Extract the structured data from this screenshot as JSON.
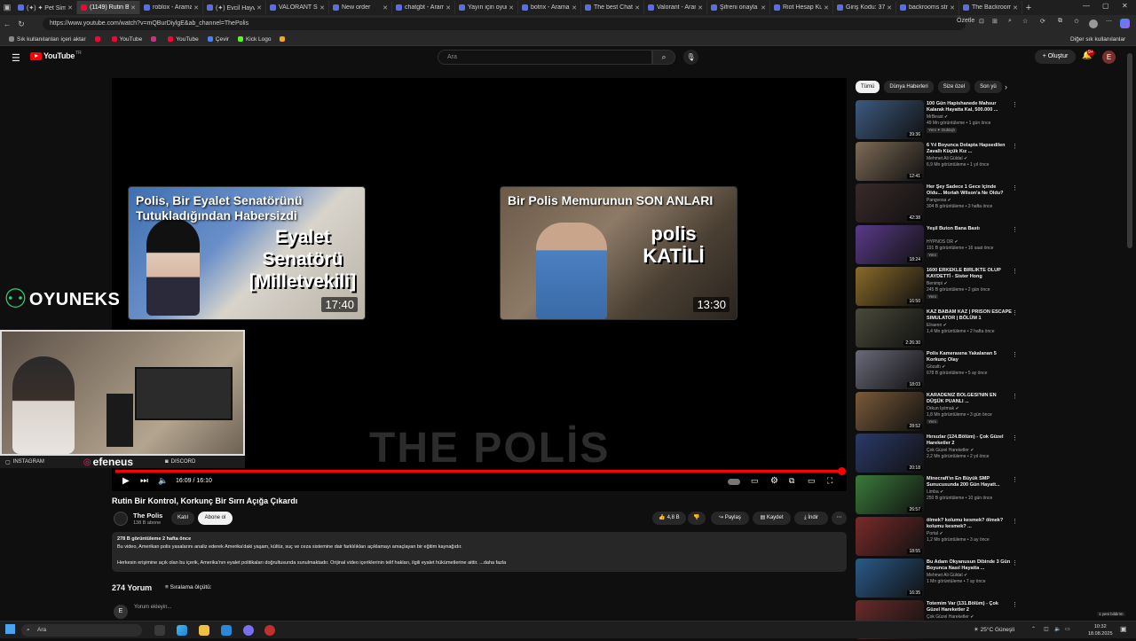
{
  "browser": {
    "tabs": [
      {
        "label": "(✦) ✦ Pet Sim"
      },
      {
        "label": "(1149) Rutin Bi",
        "active": true
      },
      {
        "label": "roblox - Arama"
      },
      {
        "label": "(✦) Evcil Hayv"
      },
      {
        "label": "VALORANT Str"
      },
      {
        "label": "New order"
      },
      {
        "label": "chatgbt - Aram"
      },
      {
        "label": "Yayın için oyun"
      },
      {
        "label": "botrix - Arama"
      },
      {
        "label": "The best Chatb"
      },
      {
        "label": "Valorant - Aram"
      },
      {
        "label": "Şifreni onayla"
      },
      {
        "label": "Riot Hesap Kur"
      },
      {
        "label": "Giriş Kodu: 37"
      },
      {
        "label": "backrooms str"
      },
      {
        "label": "The Backroom"
      }
    ],
    "url": "https://www.youtube.com/watch?v=mQBurDiylgE&ab_channel=ThePolis",
    "summarize_label": "Özetle",
    "bookmarks": [
      {
        "label": "Sık kullanılanları içeri aktar",
        "color": "#888888"
      },
      {
        "label": "",
        "color": "#ff0033"
      },
      {
        "label": "YouTube",
        "color": "#ff0033"
      },
      {
        "label": "",
        "color": "#c13584"
      },
      {
        "label": "YouTube",
        "color": "#ff0033"
      },
      {
        "label": "Çevir",
        "color": "#4285f4"
      },
      {
        "label": "Kick Logo",
        "color": "#53fc18"
      },
      {
        "label": "",
        "color": "#f5a623"
      }
    ],
    "other_bookmarks": "Diğer sık kullanılanlar"
  },
  "header": {
    "logo_text": "YouTube",
    "logo_country": "TR",
    "search_placeholder": "Ara",
    "create_label": "Oluştur",
    "notification_count": "9+",
    "avatar_letter": "E"
  },
  "player": {
    "watermark": "THE POLİS",
    "current_time": "16:09 / 16:10",
    "progress": 0.999,
    "endcards": [
      {
        "title": "Polis, Bir Eyalet Senatörünü Tutukladığından Habersizdi",
        "caption": "Eyalet Senatörü [Milletvekili]",
        "duration": "17:40"
      },
      {
        "title": "Bir Polis Memurunun SON ANLARI",
        "caption": "polis KATİLİ",
        "duration": "13:30"
      }
    ]
  },
  "overlay": {
    "brand": "OYUNEKS",
    "instagram": "INSTAGRAM",
    "streamer_name": "efeneus",
    "discord": "DISCORD"
  },
  "video": {
    "title": "Rutin Bir Kontrol, Korkunç Bir Sırrı Açığa Çıkardı",
    "channel": "The Polis",
    "subscribers": "138 B abone",
    "join_label": "Katıl",
    "subscribe_label": "Abone ol",
    "likes": "4,8 B",
    "share_label": "Paylaş",
    "save_label": "Kaydet",
    "download_label": "İndir",
    "desc_stats": "278 B görüntüleme  2 hafta önce",
    "desc_line1": "Bu video, Amerikan polis yasalarını analiz ederek Amerika'daki yaşam, kültür, suç ve ceza sistemine dair farklılıkları açıklamayı amaçlayan bir eğitim kaynağıdır.",
    "desc_line2": "Herkesin erişimine açık olan bu içerik, Amerika'nın eyalet politikaları doğrultusunda sunulmaktadır. Orijinal video içeriklerinin telif hakları, ilgili eyalet hükümetlerine aittir. ...daha fazla"
  },
  "comments": {
    "count_label": "274 Yorum",
    "sort_label": "Sıralama ölçütü:",
    "input_placeholder": "Yorum ekleyin...",
    "avatar_letter": "E"
  },
  "sidebar": {
    "chips": [
      "Tümü",
      "Dünya Haberleri",
      "Size özel",
      "Son yü"
    ],
    "items": [
      {
        "title": "100 Gün Hapishanede Mahsur Kalarak Hayatta Kal, 500.000 ...",
        "channel": "MrBeast",
        "meta": "49 Mn görüntüleme • 1 gün önce",
        "badge": "Yeni   ✦ Dublajlı",
        "duration": "39:36",
        "color": "#3d5a80"
      },
      {
        "title": "6 Yıl Boyunca Dolapta Hapsedilen Zavallı Küçük Kız ...",
        "channel": "Mehmet Ali Güldal",
        "meta": "6,9 Mn görüntüleme • 1 yıl önce",
        "badge": "",
        "duration": "12:41",
        "color": "#7d6b57"
      },
      {
        "title": "Her Şey Sadece 1 Gece İçinde Oldu... Moriah Wilson'a Ne Oldu?",
        "channel": "Pangvosa",
        "meta": "304 B görüntüleme • 3 hafta önce",
        "badge": "",
        "duration": "42:38",
        "color": "#3a2a2a"
      },
      {
        "title": "Yeşil Buton Bana Bastı",
        "channel": "HYPNOS OR",
        "meta": "191 B görüntüleme • 16 saat önce",
        "badge": "Yeni",
        "duration": "18:24",
        "color": "#5a3a8a"
      },
      {
        "title": "1600 ERKEKLE BİRLİKTE OLUP KAYDETTİ - Sister Hong",
        "channel": "Benimpi",
        "meta": "245 B görüntüleme • 2 gün önce",
        "badge": "Yeni",
        "duration": "16:50",
        "color": "#8a6a2a"
      },
      {
        "title": "KAZ BABAM KAZ | PRISON ESCAPE SIMULATOR | BÖLÜM 1",
        "channel": "Elraenn",
        "meta": "1,4 Mn görüntüleme • 2 hafta önce",
        "badge": "",
        "duration": "2:26:30",
        "color": "#4a4a3a"
      },
      {
        "title": "Polis Kamerasına Yakalanan 5 Korkunç Olay",
        "channel": "Gözaltı",
        "meta": "678 B görüntüleme • 5 ay önce",
        "badge": "",
        "duration": "18:03",
        "color": "#6a6a7a"
      },
      {
        "title": "KARADENİZ BÖLGESİ'NİN EN DÜŞÜK PUANLI ...",
        "channel": "Orkun Işıtmak",
        "meta": "1,8 Mn görüntüleme • 3 gün önce",
        "badge": "Yeni",
        "duration": "28:52",
        "color": "#7a5a3a"
      },
      {
        "title": "Hırsızlar (124.Bölüm) - Çok Güzel Hareketler 2",
        "channel": "Çok Güzel Hareketler",
        "meta": "2,2 Mn görüntüleme • 2 yıl önce",
        "badge": "",
        "duration": "20:18",
        "color": "#2a3a6a"
      },
      {
        "title": "Minecraft'ın En Büyük SMP Sunucusunda 200 Gün Hayatt...",
        "channel": "Limba",
        "meta": "250 B görüntüleme • 10 gün önce",
        "badge": "",
        "duration": "26:57",
        "color": "#3a7a3a"
      },
      {
        "title": "ölmek? kolumu kesmek? ölmek? kolumu kesmek? ...",
        "channel": "Portal",
        "meta": "1,2 Mn görüntüleme • 3 ay önce",
        "badge": "",
        "duration": "18:55",
        "color": "#7a2a2a"
      },
      {
        "title": "Bu Adam Okyanusun Dibinde 3 Gün Boyunca Nasıl Hayatta ...",
        "channel": "Mehmet Ali Güldal",
        "meta": "1 Mn görüntüleme • 7 ay önce",
        "badge": "",
        "duration": "16:35",
        "color": "#2a5a8a"
      },
      {
        "title": "Totemim Var (131.Bölüm) - Çok Güzel Hareketler 2",
        "channel": "Çok Güzel Hareketler",
        "meta": "",
        "badge": "",
        "duration": "",
        "color": "#6a2a2a"
      }
    ]
  },
  "taskbar": {
    "search_placeholder": "Ara",
    "weather": "25°C  Güneşli",
    "time": "10:32",
    "date": "18.08.2025",
    "activate_text": "1 yeni bildirim"
  }
}
